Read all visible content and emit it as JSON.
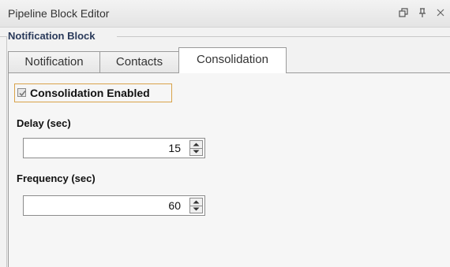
{
  "window": {
    "title": "Pipeline Block Editor",
    "buttons": {
      "restore": "⧉",
      "pin": "ꟼ",
      "close": "×"
    }
  },
  "group": {
    "title": "Notification Block"
  },
  "tabs": [
    {
      "label": "Notification",
      "active": false
    },
    {
      "label": "Contacts",
      "active": false
    },
    {
      "label": "Consolidation",
      "active": true
    }
  ],
  "consolidation": {
    "enabled_label": "Consolidation Enabled",
    "enabled": true,
    "delay": {
      "label": "Delay (sec)",
      "value": "15"
    },
    "frequency": {
      "label": "Frequency (sec)",
      "value": "60"
    }
  },
  "icons": {
    "restore": "restore-window-icon",
    "pin": "pin-icon",
    "close": "close-icon",
    "check": "check-icon",
    "spin_up": "triangle-up-icon",
    "spin_down": "triangle-down-icon"
  }
}
